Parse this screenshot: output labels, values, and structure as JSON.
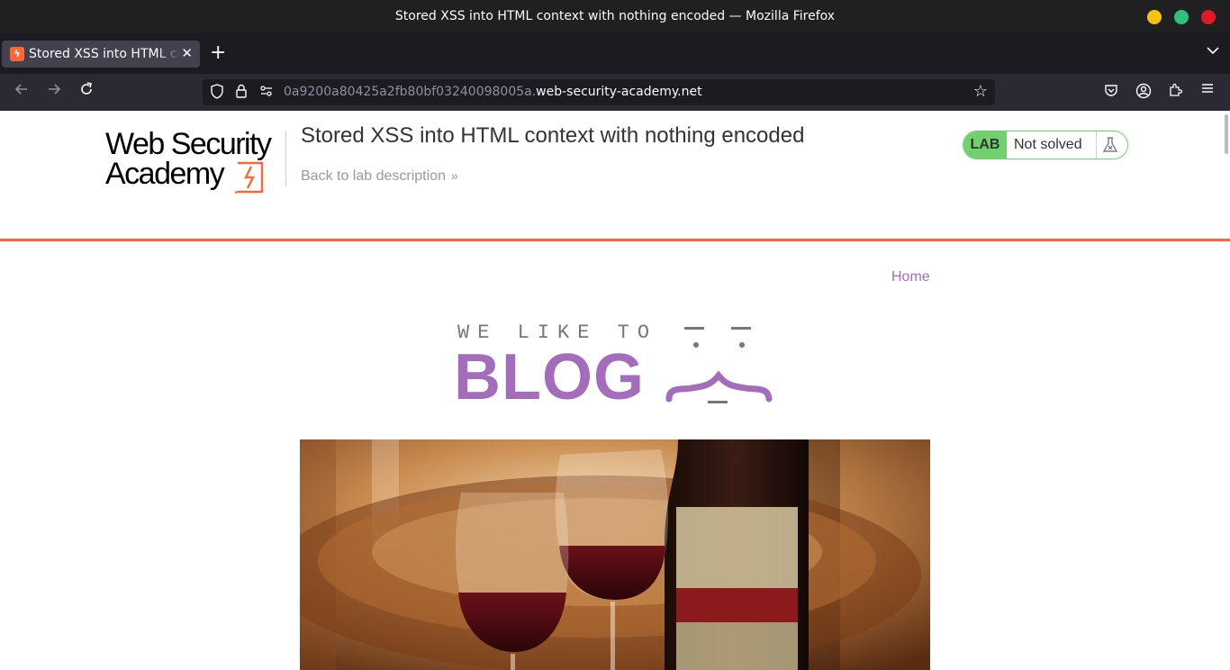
{
  "window": {
    "title": "Stored XSS into HTML context with nothing encoded — Mozilla Firefox"
  },
  "tab": {
    "label": "Stored XSS into HTML context with nothing encoded",
    "favicon": "web-security-academy-icon"
  },
  "navbar": {
    "url_prefix": "0a9200a80425a2fb80bf03240098005a.",
    "url_host": "web-security-academy.net"
  },
  "header": {
    "logo_line1": "Web Security",
    "logo_line2": "Academy",
    "lab_title": "Stored XSS into HTML context with nothing encoded",
    "back_link": "Back to lab description",
    "badge_tag": "LAB",
    "badge_status": "Not solved",
    "accent_color": "#ff6633",
    "badge_color": "#70d16d"
  },
  "blog": {
    "nav_home": "Home",
    "tagline": "WE LIKE TO",
    "wordmark": "BLOG",
    "brand_color": "#a46dbc",
    "hero_image": "wine-glasses-and-bottle-on-barrel-photo"
  }
}
